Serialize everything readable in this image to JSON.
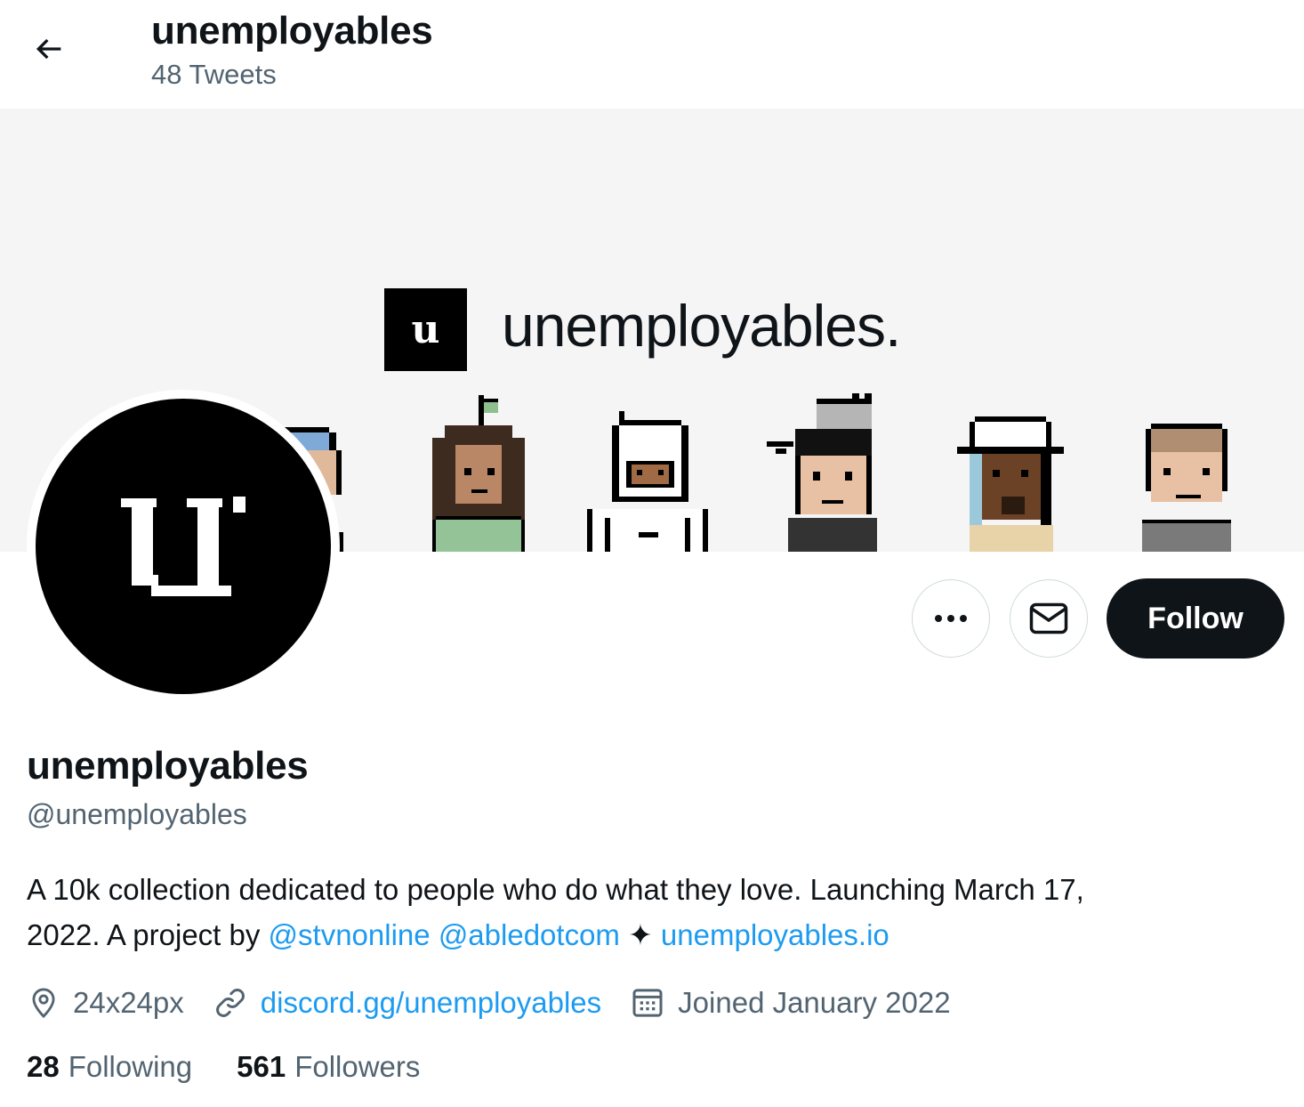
{
  "header": {
    "title": "unemployables",
    "tweet_count": "48 Tweets"
  },
  "banner": {
    "logo_mark": "u",
    "wordmark": "unemployables."
  },
  "avatar": {
    "logo_mark": "u"
  },
  "actions": {
    "follow_label": "Follow"
  },
  "profile": {
    "display_name": "unemployables",
    "handle": "@unemployables",
    "bio": {
      "line1": "A 10k collection dedicated to people who do what they love. Launching March 17,",
      "line2_prefix": "2022. A project by ",
      "mention1": "@stvnonline",
      "mention2": "@abledotcom",
      "sparkle": "✦",
      "website": "unemployables.io"
    },
    "location": "24x24px",
    "url": "discord.gg/unemployables",
    "joined": "Joined January 2022",
    "following_count": "28",
    "following_label": "Following",
    "followers_count": "561",
    "followers_label": "Followers"
  },
  "colors": {
    "accent": "#1d9bf0",
    "text": "#0f1419",
    "muted": "#536471",
    "border": "#cfd9de",
    "banner_bg": "#f5f5f5"
  }
}
